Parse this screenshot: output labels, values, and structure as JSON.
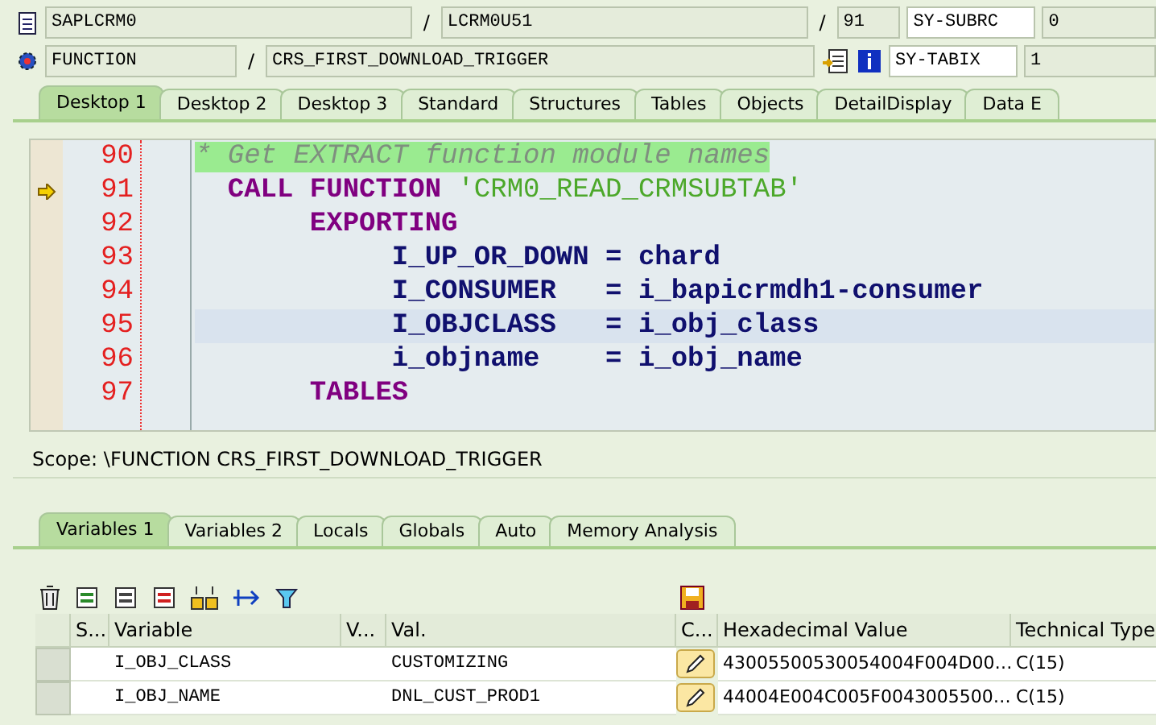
{
  "header_rows": [
    {
      "fields": [
        {
          "kind": "field",
          "text": "SAPLCRM0"
        },
        {
          "kind": "sep",
          "text": "/"
        },
        {
          "kind": "field",
          "text": "LCRM0U51"
        },
        {
          "kind": "sep",
          "text": "/"
        },
        {
          "kind": "field",
          "text": "91"
        },
        {
          "kind": "label",
          "text": "SY-SUBRC"
        },
        {
          "kind": "field",
          "text": "0"
        }
      ]
    },
    {
      "fields": [
        {
          "kind": "field",
          "text": "FUNCTION"
        },
        {
          "kind": "sep",
          "text": "/"
        },
        {
          "kind": "field",
          "text": "CRS_FIRST_DOWNLOAD_TRIGGER"
        },
        {
          "kind": "tools"
        },
        {
          "kind": "label",
          "text": "SY-TABIX"
        },
        {
          "kind": "field",
          "text": "1"
        }
      ]
    }
  ],
  "desktop_tabs": [
    {
      "label": "Desktop 1",
      "selected": true
    },
    {
      "label": "Desktop 2",
      "selected": false
    },
    {
      "label": "Desktop 3",
      "selected": false
    },
    {
      "label": "Standard",
      "selected": false
    },
    {
      "label": "Structures",
      "selected": false
    },
    {
      "label": "Tables",
      "selected": false
    },
    {
      "label": "Objects",
      "selected": false
    },
    {
      "label": "DetailDisplay",
      "selected": false
    },
    {
      "label": "Data E",
      "selected": false
    }
  ],
  "code_lines": [
    {
      "number": "90",
      "marker": false,
      "current": false,
      "tokens": [
        {
          "kind": "comment",
          "text": "* Get EXTRACT function module names"
        }
      ]
    },
    {
      "number": "91",
      "marker": true,
      "current": false,
      "tokens": [
        {
          "kind": "keyword",
          "text": "  CALL FUNCTION "
        },
        {
          "kind": "string",
          "text": "'CRM0_READ_CRMSUBTAB'"
        }
      ]
    },
    {
      "number": "92",
      "marker": false,
      "current": false,
      "tokens": [
        {
          "kind": "keyword",
          "text": "       EXPORTING"
        }
      ]
    },
    {
      "number": "93",
      "marker": false,
      "current": false,
      "tokens": [
        {
          "kind": "ident",
          "text": "            I_UP_OR_DOWN = chard"
        }
      ]
    },
    {
      "number": "94",
      "marker": false,
      "current": false,
      "tokens": [
        {
          "kind": "ident",
          "text": "            I_CONSUMER   = i_bapicrmdh1-consumer"
        }
      ]
    },
    {
      "number": "95",
      "marker": false,
      "current": true,
      "tokens": [
        {
          "kind": "ident",
          "text": "            I_OBJCLASS   = i_obj_class"
        }
      ]
    },
    {
      "number": "96",
      "marker": false,
      "current": false,
      "tokens": [
        {
          "kind": "ident",
          "text": "            i_objname    = i_obj_name"
        }
      ]
    },
    {
      "number": "97",
      "marker": false,
      "current": false,
      "tokens": [
        {
          "kind": "keyword",
          "text": "       TABLES"
        }
      ]
    }
  ],
  "scope": "Scope: \\FUNCTION CRS_FIRST_DOWNLOAD_TRIGGER",
  "variable_tabs": [
    {
      "label": "Variables 1",
      "selected": true
    },
    {
      "label": "Variables 2",
      "selected": false
    },
    {
      "label": "Locals",
      "selected": false
    },
    {
      "label": "Globals",
      "selected": false
    },
    {
      "label": "Auto",
      "selected": false
    },
    {
      "label": "Memory Analysis",
      "selected": false
    }
  ],
  "table": {
    "columns": [
      "S...",
      "Variable",
      "V...",
      "Val.",
      "C...",
      "Hexadecimal Value",
      "Technical Type"
    ],
    "rows": [
      {
        "variable": "I_OBJ_CLASS",
        "value": "CUSTOMIZING",
        "hex": "43005500530054004F004D00…",
        "type": "C(15)"
      },
      {
        "variable": "I_OBJ_NAME",
        "value": "DNL_CUST_PROD1",
        "hex": "44004E004C005F0043005500…",
        "type": "C(15)"
      }
    ]
  }
}
